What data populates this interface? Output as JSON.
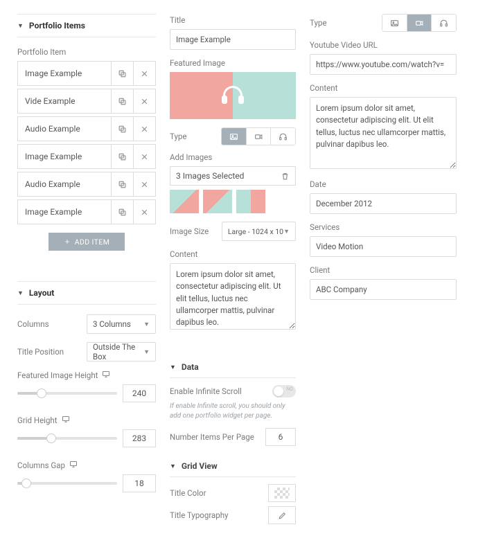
{
  "portfolio": {
    "section_title": "Portfolio Items",
    "list_label": "Portfolio Item",
    "items": [
      {
        "title": "Image Example"
      },
      {
        "title": "Vide Example"
      },
      {
        "title": "Audio Example"
      },
      {
        "title": "Image Example"
      },
      {
        "title": "Audio Example"
      },
      {
        "title": "Image Example"
      }
    ],
    "add_item_label": "ADD ITEM"
  },
  "editor": {
    "title_label": "Title",
    "title_value": "Image Example",
    "featured_label": "Featured Image",
    "type_label": "Type",
    "add_images_label": "Add Images",
    "images_selected_text": "3 Images Selected",
    "image_size_label": "Image Size",
    "image_size_value": "Large - 1024 x 10",
    "content_label": "Content",
    "content_value": "Lorem ipsum dolor sit amet, consectetur adipiscing elit. Ut elit tellus, luctus nec ullamcorper mattis, pulvinar dapibus leo."
  },
  "right": {
    "type_label": "Type",
    "youtube_label": "Youtube Video URL",
    "youtube_value": "https://www.youtube.com/watch?v=",
    "content_label": "Content",
    "content_value": "Lorem ipsum dolor sit amet, consectetur adipiscing elit. Ut elit tellus, luctus nec ullamcorper mattis, pulvinar dapibus leo.",
    "date_label": "Date",
    "date_value": "December 2012",
    "services_label": "Services",
    "services_value": "Video Motion",
    "client_label": "Client",
    "client_value": "ABC Company"
  },
  "layout": {
    "section_title": "Layout",
    "columns_label": "Columns",
    "columns_value": "3 Columns",
    "title_pos_label": "Title Position",
    "title_pos_value": "Outside The Box",
    "feat_height_label": "Featured Image Height",
    "feat_height_value": "240",
    "grid_height_label": "Grid Height",
    "grid_height_value": "283",
    "cols_gap_label": "Columns Gap",
    "cols_gap_value": "18"
  },
  "data": {
    "section_title": "Data",
    "infinite_label": "Enable Infinite Scroll",
    "infinite_hint": "If enable Infinite scroll, you should only add one portfolio widget per page.",
    "per_page_label": "Number Items Per Page",
    "per_page_value": "6",
    "grid_view_title": "Grid View",
    "title_color_label": "Title Color",
    "title_typo_label": "Title Typography"
  }
}
